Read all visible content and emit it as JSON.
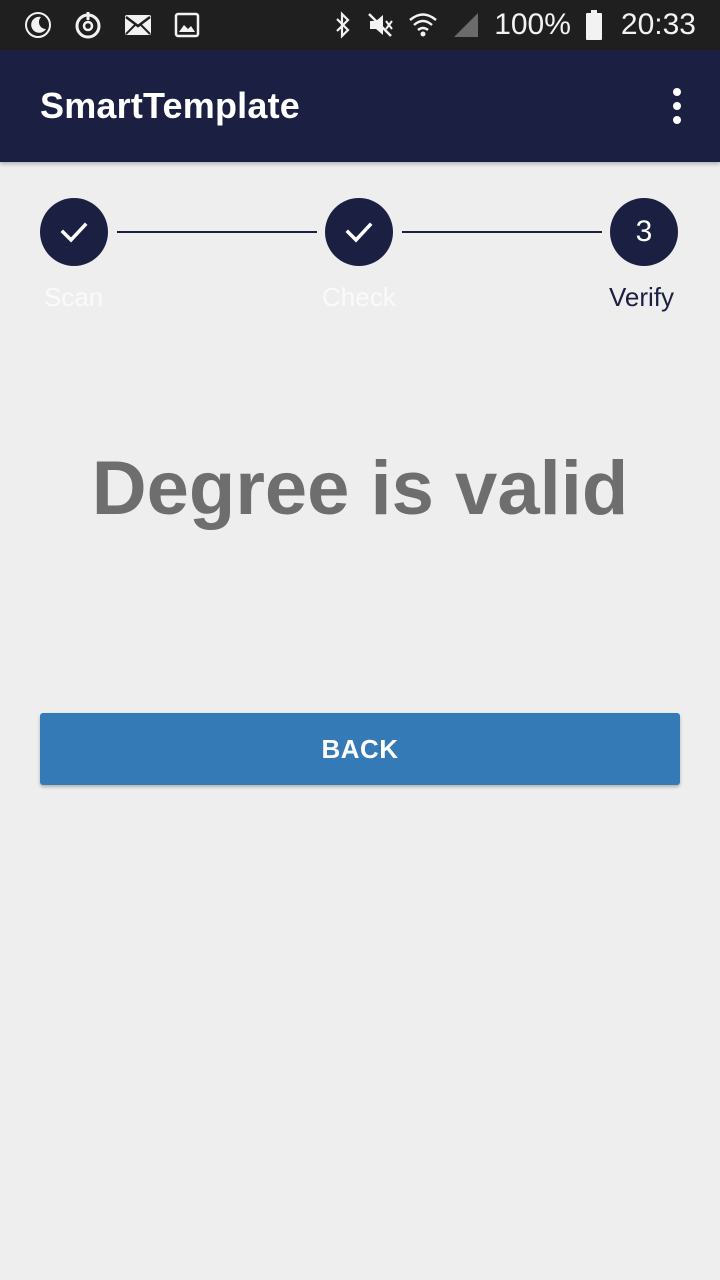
{
  "status_bar": {
    "left_icons": [
      "moon-icon",
      "data-saver-icon",
      "mail-icon",
      "image-icon"
    ],
    "right_icons": [
      "bluetooth-icon",
      "mute-icon",
      "wifi-icon",
      "signal-icon",
      "battery-icon"
    ],
    "battery": "100%",
    "time": "20:33"
  },
  "app_bar": {
    "title": "SmartTemplate",
    "menu_icon": "overflow-menu-icon"
  },
  "stepper": {
    "steps": [
      {
        "label": "Scan",
        "state": "completed",
        "icon": "check-icon"
      },
      {
        "label": "Check",
        "state": "completed",
        "icon": "check-icon"
      },
      {
        "label": "Verify",
        "state": "active",
        "number": "3"
      }
    ]
  },
  "main": {
    "message": "Degree is valid",
    "back_label": "BACK"
  },
  "colors": {
    "primary_dark": "#1b1f42",
    "button": "#337ab7",
    "message_text": "#6e6e6e",
    "background": "#eeeeee"
  }
}
